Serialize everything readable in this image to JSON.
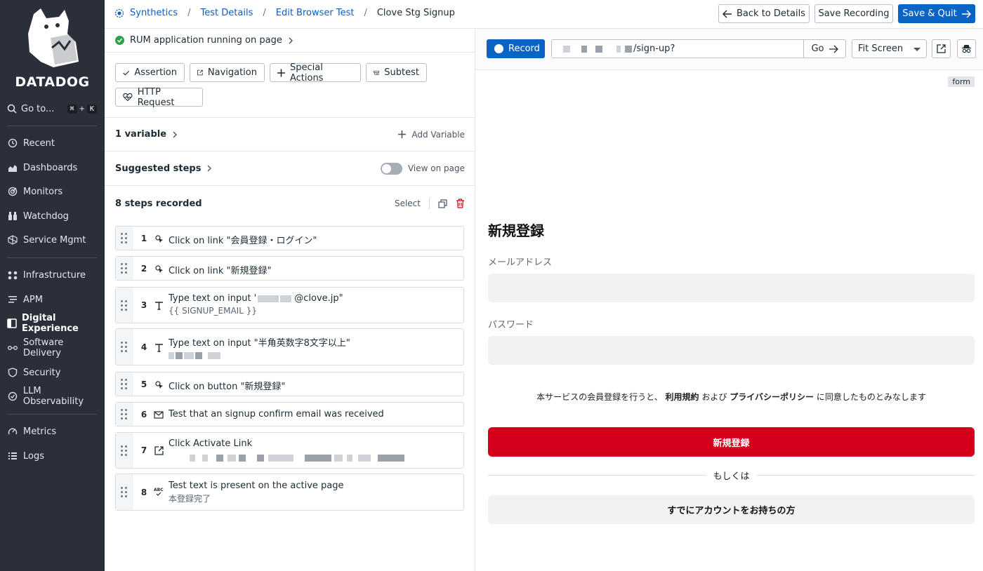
{
  "sidebar": {
    "logo_text": "DATADOG",
    "goto_label": "Go to...",
    "goto_key1": "⌘",
    "goto_plus": "+",
    "goto_key2": "K",
    "items": [
      {
        "label": "Recent",
        "icon": "history-icon"
      },
      {
        "label": "Dashboards",
        "icon": "chart-area-icon"
      },
      {
        "label": "Monitors",
        "icon": "radar-icon"
      },
      {
        "label": "Watchdog",
        "icon": "binoculars-icon"
      },
      {
        "label": "Service Mgmt",
        "icon": "cube-icon"
      },
      {
        "label": "Infrastructure",
        "icon": "nodes-icon"
      },
      {
        "label": "APM",
        "icon": "list-lines-icon"
      },
      {
        "label": "Digital Experience",
        "icon": "monitor-icon"
      },
      {
        "label": "Software Delivery",
        "icon": "pipeline-icon"
      },
      {
        "label": "Security",
        "icon": "shield-icon"
      },
      {
        "label": "LLM Observability",
        "icon": "llm-icon"
      },
      {
        "label": "Metrics",
        "icon": "gauge-icon"
      },
      {
        "label": "Logs",
        "icon": "logs-icon"
      }
    ]
  },
  "breadcrumb": {
    "items": [
      "Synthetics",
      "Test Details",
      "Edit Browser Test"
    ],
    "current": "Clove Stg Signup",
    "separator": "/"
  },
  "toolbar": {
    "back_label": "Back to Details",
    "save_recording_label": "Save Recording",
    "save_quit_label": "Save & Quit"
  },
  "rum": {
    "label": "RUM application running on page"
  },
  "actions": {
    "assertion": "Assertion",
    "navigation": "Navigation",
    "special_actions": "Special Actions",
    "subtest": "Subtest",
    "http_request": "HTTP Request"
  },
  "variables": {
    "title": "1 variable",
    "add_label": "Add Variable"
  },
  "suggested": {
    "title": "Suggested steps",
    "toggle_label": "View on page"
  },
  "steps_header": {
    "title": "8 steps recorded",
    "select_label": "Select"
  },
  "steps": [
    {
      "num": "1",
      "text": "Click on link \"会員登録・ログイン\"",
      "icon": "click-icon"
    },
    {
      "num": "2",
      "text": "Click on link \"新規登録\"",
      "icon": "click-icon"
    },
    {
      "num": "3",
      "text_prefix": "Type text on input '",
      "text_suffix": "@clove.jp\"",
      "sub": "{{ SIGNUP_EMAIL }}",
      "icon": "text-icon"
    },
    {
      "num": "4",
      "text": "Type text on input \"半角英数字8文字以上\"",
      "icon": "text-icon"
    },
    {
      "num": "5",
      "text": "Click on button \"新規登録\"",
      "icon": "click-icon"
    },
    {
      "num": "6",
      "text": "Test that an signup confirm email was received",
      "icon": "mail-icon"
    },
    {
      "num": "7",
      "text": "Click Activate Link",
      "icon": "external-link-icon"
    },
    {
      "num": "8",
      "text": "Test text is present on the active page",
      "sub": "本登録完了",
      "icon": "abc-check-icon"
    }
  ],
  "recorder": {
    "record_label": "Record",
    "url_suffix": "/sign-up?",
    "go_label": "Go",
    "fit_label": "Fit Screen"
  },
  "preview": {
    "form_tag": "form",
    "title": "新規登録",
    "email_label": "メールアドレス",
    "password_label": "パスワード",
    "terms_prefix": "本サービスの会員登録を行うと、",
    "terms_link1": "利用規約",
    "terms_mid": "および",
    "terms_link2": "プライバシーポリシー",
    "terms_suffix": "に同意したものとみなします",
    "primary_button": "新規登録",
    "or_label": "もしくは",
    "secondary_button": "すでにアカウントをお持ちの方"
  },
  "colors": {
    "sidebar_bg": "#2b2f3a",
    "primary_blue": "#0a64c4",
    "link_blue": "#0a5fbf",
    "danger_red": "#d7001c",
    "success_green": "#2ba14b"
  }
}
